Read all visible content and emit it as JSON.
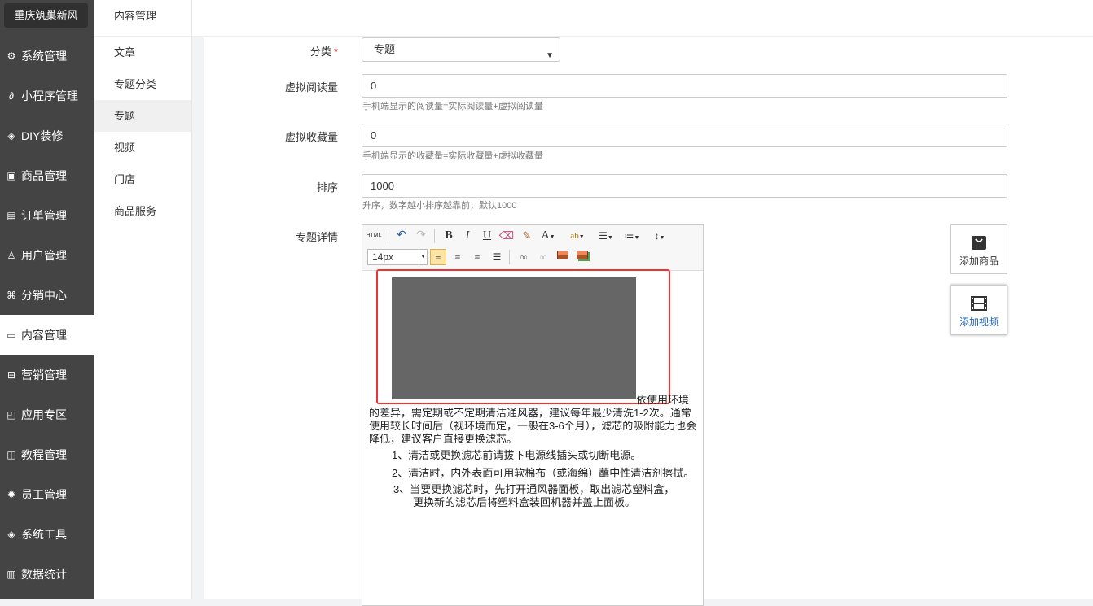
{
  "app": {
    "logo": "重庆筑巢新风"
  },
  "sidebar": {
    "items": [
      {
        "label": "系统管理",
        "icon": "gear-icon",
        "glyph": "⚙"
      },
      {
        "label": "小程序管理",
        "icon": "link-icon",
        "glyph": "∂"
      },
      {
        "label": "DIY装修",
        "icon": "diamond-icon",
        "glyph": "◈"
      },
      {
        "label": "商品管理",
        "icon": "package-icon",
        "glyph": "▣"
      },
      {
        "label": "订单管理",
        "icon": "clipboard-icon",
        "glyph": "▤"
      },
      {
        "label": "用户管理",
        "icon": "user-icon",
        "glyph": "♙"
      },
      {
        "label": "分销中心",
        "icon": "network-icon",
        "glyph": "⌘"
      },
      {
        "label": "内容管理",
        "icon": "content-icon",
        "glyph": "▭"
      },
      {
        "label": "营销管理",
        "icon": "ticket-icon",
        "glyph": "⊟"
      },
      {
        "label": "应用专区",
        "icon": "app-icon",
        "glyph": "◰"
      },
      {
        "label": "教程管理",
        "icon": "book-icon",
        "glyph": "◫"
      },
      {
        "label": "员工管理",
        "icon": "cog-icon",
        "glyph": "✹"
      },
      {
        "label": "系统工具",
        "icon": "tools-icon",
        "glyph": "◈"
      },
      {
        "label": "数据统计",
        "icon": "bar-chart-icon",
        "glyph": "▥"
      }
    ],
    "active_index": 7
  },
  "subnav": {
    "title": "内容管理",
    "items": [
      "文章",
      "专题分类",
      "专题",
      "视频",
      "门店",
      "商品服务"
    ],
    "active_index": 2
  },
  "form": {
    "category": {
      "label": "分类",
      "required_mark": "*",
      "value": "专题"
    },
    "virtual_reads": {
      "label": "虚拟阅读量",
      "value": "0",
      "help": "手机端显示的阅读量=实际阅读量+虚拟阅读量"
    },
    "virtual_favs": {
      "label": "虚拟收藏量",
      "value": "0",
      "help": "手机端显示的收藏量=实际收藏量+虚拟收藏量"
    },
    "sort": {
      "label": "排序",
      "value": "1000",
      "help": "升序，数字越小排序越靠前，默认1000"
    },
    "detail": {
      "label": "专题详情"
    }
  },
  "editor": {
    "font_size": "14px",
    "html_label": "HTML",
    "bold": "B",
    "italic": "I",
    "underline": "U",
    "font_color": "A",
    "highlight": "ab",
    "content": {
      "line1_tail": "依使用环境",
      "para1": "的差异，需定期或不定期清洁通风器，建议每年最少清洗1-2次。通常使用较长时间后（视环境而定，一般在3-6个月），滤芯的吸附能力也会降低，建议客户直接更换滤芯。",
      "item1": "1、清洁或更换滤芯前请拔下电源线插头或切断电源。",
      "item2": "2、清洁时，内外表面可用软棉布（或海绵）蘸中性清洁剂擦拭。",
      "item3a": "3、当要更换滤芯时，先打开通风器面板，取出滤芯塑料盒，",
      "item3b": "更换新的滤芯后将塑料盒装回机器并盖上面板。"
    }
  },
  "side_buttons": {
    "add_product": "添加商品",
    "add_video": "添加视频"
  },
  "colors": {
    "sidebar_bg": "#444444",
    "highlight_red": "#e33333",
    "link_blue": "#1e5fb4"
  }
}
